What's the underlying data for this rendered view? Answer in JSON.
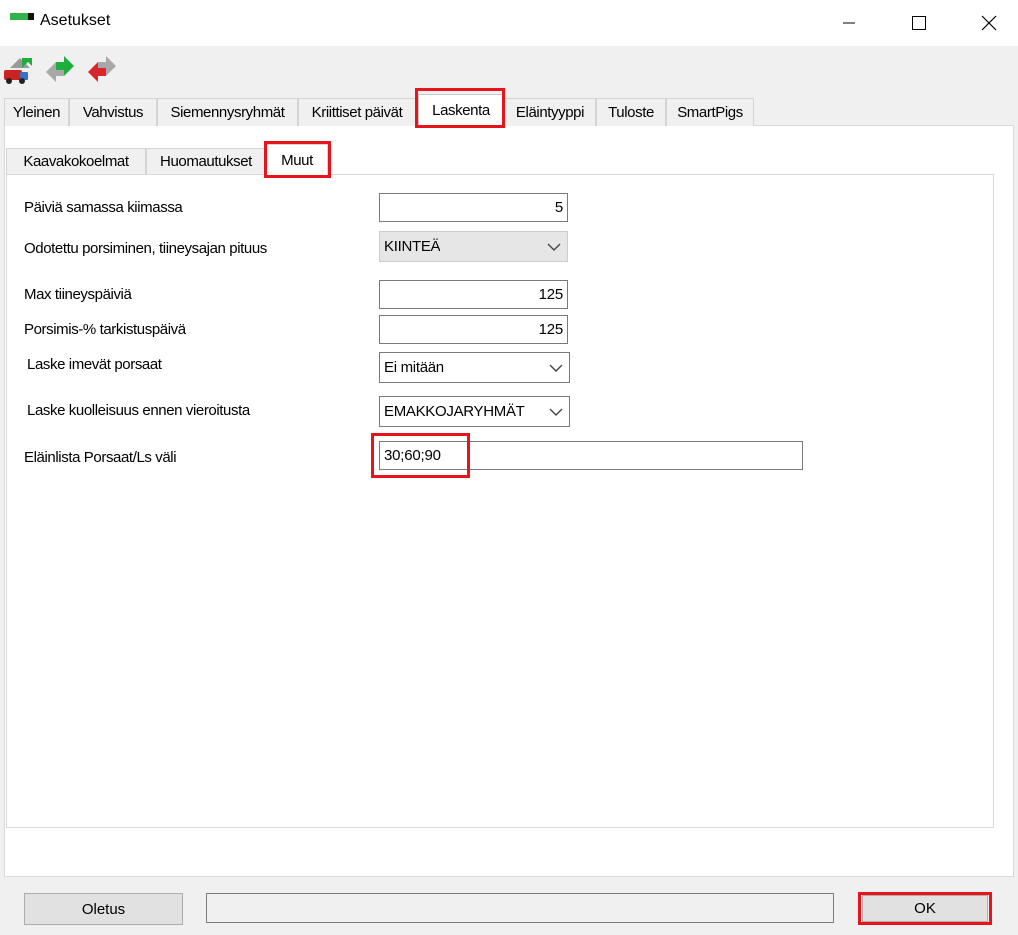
{
  "window": {
    "title": "Asetukset",
    "colors": {
      "logo_green": "#2fb34a",
      "highlight": "#e8141c"
    }
  },
  "toolbar": {
    "icons": [
      "truck-import-icon",
      "green-arrows-icon",
      "red-arrows-icon"
    ]
  },
  "main_tabs": [
    {
      "label": "Yleinen"
    },
    {
      "label": "Vahvistus"
    },
    {
      "label": "Siemennysryhmät"
    },
    {
      "label": "Kriittiset päivät"
    },
    {
      "label": "Laskenta",
      "active": true
    },
    {
      "label": "Eläintyyppi"
    },
    {
      "label": "Tuloste"
    },
    {
      "label": "SmartPigs"
    }
  ],
  "sub_tabs": [
    {
      "label": "Kaavakokoelmat"
    },
    {
      "label": "Huomautukset"
    },
    {
      "label": "Muut",
      "active": true
    }
  ],
  "form": {
    "paivia_samassa_kiimassa": {
      "label": "Päiviä samassa kiimassa",
      "value": "5"
    },
    "odotettu_porsiminen": {
      "label": "Odotettu porsiminen, tiineysajan pituus",
      "value": "KIINTEÄ"
    },
    "max_tiineyspaivia": {
      "label": "Max tiineyspäiviä",
      "value": "125"
    },
    "porsimis_tarkistuspaiva": {
      "label": "Porsimis-% tarkistuspäivä",
      "value": "125"
    },
    "laske_imevat": {
      "label": "Laske imevät porsaat",
      "value": "Ei mitään"
    },
    "laske_kuolleisuus": {
      "label": "Laske kuolleisuus ennen vieroitusta",
      "value": "EMAKKOJARYHMÄT"
    },
    "elainlista": {
      "label": "Eläinlista Porsaat/Ls väli",
      "value": "30;60;90"
    }
  },
  "bottom": {
    "default_button": "Oletus",
    "status_text": "",
    "ok_button": "OK"
  }
}
